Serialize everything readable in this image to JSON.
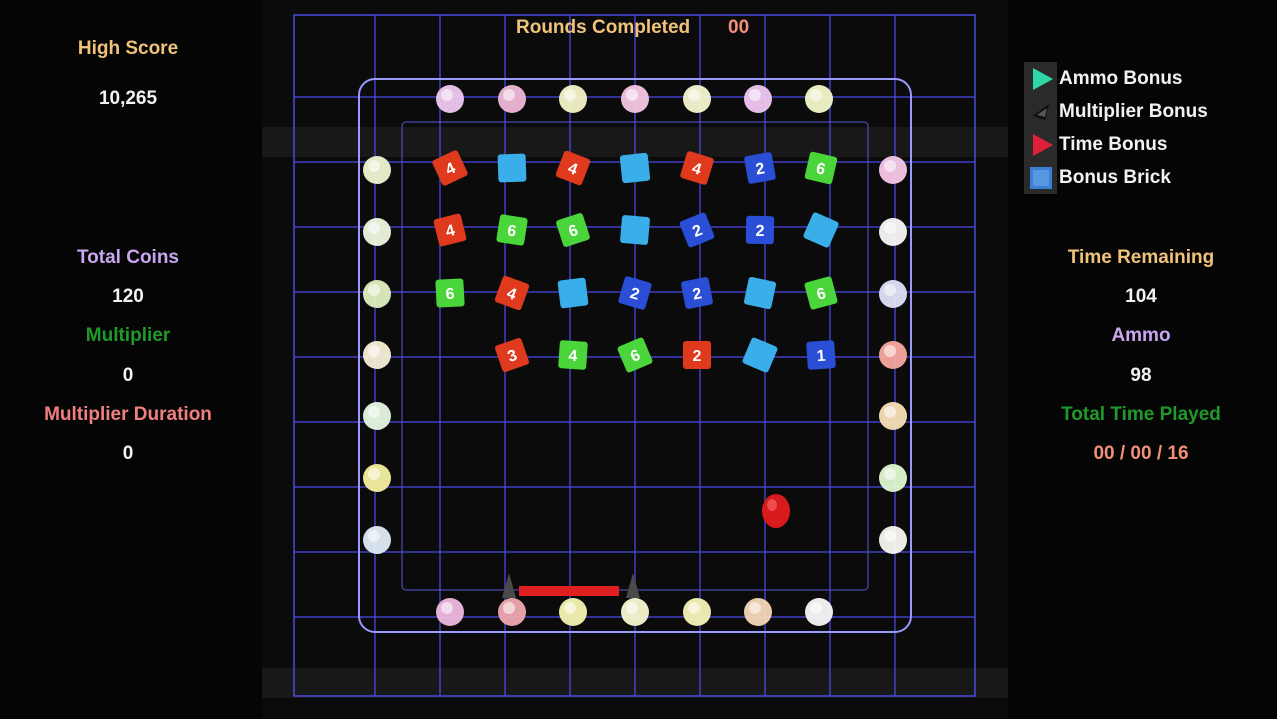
{
  "hud_left": {
    "high_score_label": "High Score",
    "high_score_value": "10,265",
    "total_coins_label": "Total Coins",
    "total_coins_value": "120",
    "multiplier_label": "Multiplier",
    "multiplier_value": "0",
    "multiplier_duration_label": "Multiplier Duration",
    "multiplier_duration_value": "0"
  },
  "hud_right": {
    "time_remaining_label": "Time Remaining",
    "time_remaining_value": "104",
    "ammo_label": "Ammo",
    "ammo_value": "98",
    "total_time_played_label": "Total Time Played",
    "total_time_played_value": "00 / 00 / 16"
  },
  "rounds": {
    "label": "Rounds Completed",
    "value": "00"
  },
  "legend": [
    {
      "label": "Ammo Bonus",
      "icon": "ammo-bonus-icon"
    },
    {
      "label": "Multiplier Bonus",
      "icon": "multiplier-bonus-icon"
    },
    {
      "label": "Time Bonus",
      "icon": "time-bonus-icon"
    },
    {
      "label": "Bonus Brick",
      "icon": "bonus-brick-icon"
    }
  ],
  "colors": {
    "high_score": "#f0c37a",
    "total_coins": "#c9a6f0",
    "multiplier": "#1f9a2a",
    "multiplier_duration": "#f08080",
    "time_remaining": "#f0c37a",
    "ammo": "#c9a6f0",
    "total_time_played": "#1f9a2a",
    "total_time_played_value": "#f0907a",
    "grid": "#4a4ae6",
    "paddle": "#e02020",
    "ball": "#d81a1a"
  },
  "bricks": [
    [
      {
        "c": "red",
        "n": "4"
      },
      {
        "c": "blue",
        "n": ""
      },
      {
        "c": "red",
        "n": "4"
      },
      {
        "c": "blue",
        "n": ""
      },
      {
        "c": "red",
        "n": "4"
      },
      {
        "c": "navy",
        "n": "2"
      },
      {
        "c": "green",
        "n": "6"
      }
    ],
    [
      {
        "c": "red",
        "n": "4"
      },
      {
        "c": "green",
        "n": "6"
      },
      {
        "c": "green",
        "n": "6"
      },
      {
        "c": "blue",
        "n": ""
      },
      {
        "c": "navy",
        "n": "2"
      },
      {
        "c": "navy",
        "n": "2"
      },
      {
        "c": "blue",
        "n": ""
      }
    ],
    [
      {
        "c": "green",
        "n": "6"
      },
      {
        "c": "red",
        "n": "4"
      },
      {
        "c": "blue",
        "n": ""
      },
      {
        "c": "navy",
        "n": "2"
      },
      {
        "c": "navy",
        "n": "2"
      },
      {
        "c": "blue",
        "n": ""
      },
      {
        "c": "green",
        "n": "6"
      }
    ],
    [
      null,
      {
        "c": "red",
        "n": "3"
      },
      {
        "c": "green",
        "n": "4"
      },
      {
        "c": "green",
        "n": "6"
      },
      {
        "c": "red",
        "n": "2"
      },
      {
        "c": "blue",
        "n": ""
      },
      {
        "c": "navy",
        "n": "1"
      }
    ]
  ]
}
